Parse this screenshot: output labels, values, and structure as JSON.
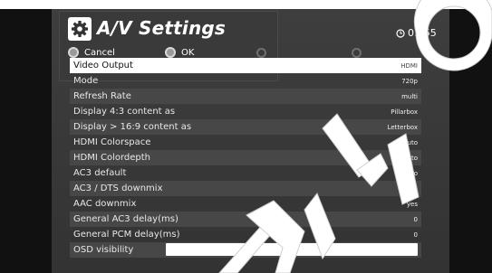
{
  "header": {
    "title": "A/V Settings",
    "time": "01:55",
    "icons": {
      "settings": "gear-icon",
      "clock": "clock-icon"
    }
  },
  "hints": [
    {
      "label": "Cancel"
    },
    {
      "label": "OK"
    }
  ],
  "settings": [
    {
      "label": "Video Output",
      "value": "HDMI",
      "selected": true
    },
    {
      "label": "Mode",
      "value": "720p"
    },
    {
      "label": "Refresh Rate",
      "value": "multi"
    },
    {
      "label": "Display 4:3 content as",
      "value": "Pillarbox"
    },
    {
      "label": "Display > 16:9 content as",
      "value": "Letterbox"
    },
    {
      "label": "HDMI Colorspace",
      "value": "Auto"
    },
    {
      "label": "HDMI Colordepth",
      "value": "Auto"
    },
    {
      "label": "AC3 default",
      "value": "no"
    },
    {
      "label": "AC3 / DTS downmix",
      "value": "yes"
    },
    {
      "label": "AAC downmix",
      "value": "yes"
    },
    {
      "label": "General AC3 delay(ms)",
      "value": "0"
    },
    {
      "label": "General PCM delay(ms)",
      "value": "0"
    },
    {
      "label": "OSD visibility",
      "value": ""
    }
  ],
  "colors": {
    "panel": "#3a3a3a",
    "row_alt": "#474747",
    "selected": "#ffffff"
  }
}
